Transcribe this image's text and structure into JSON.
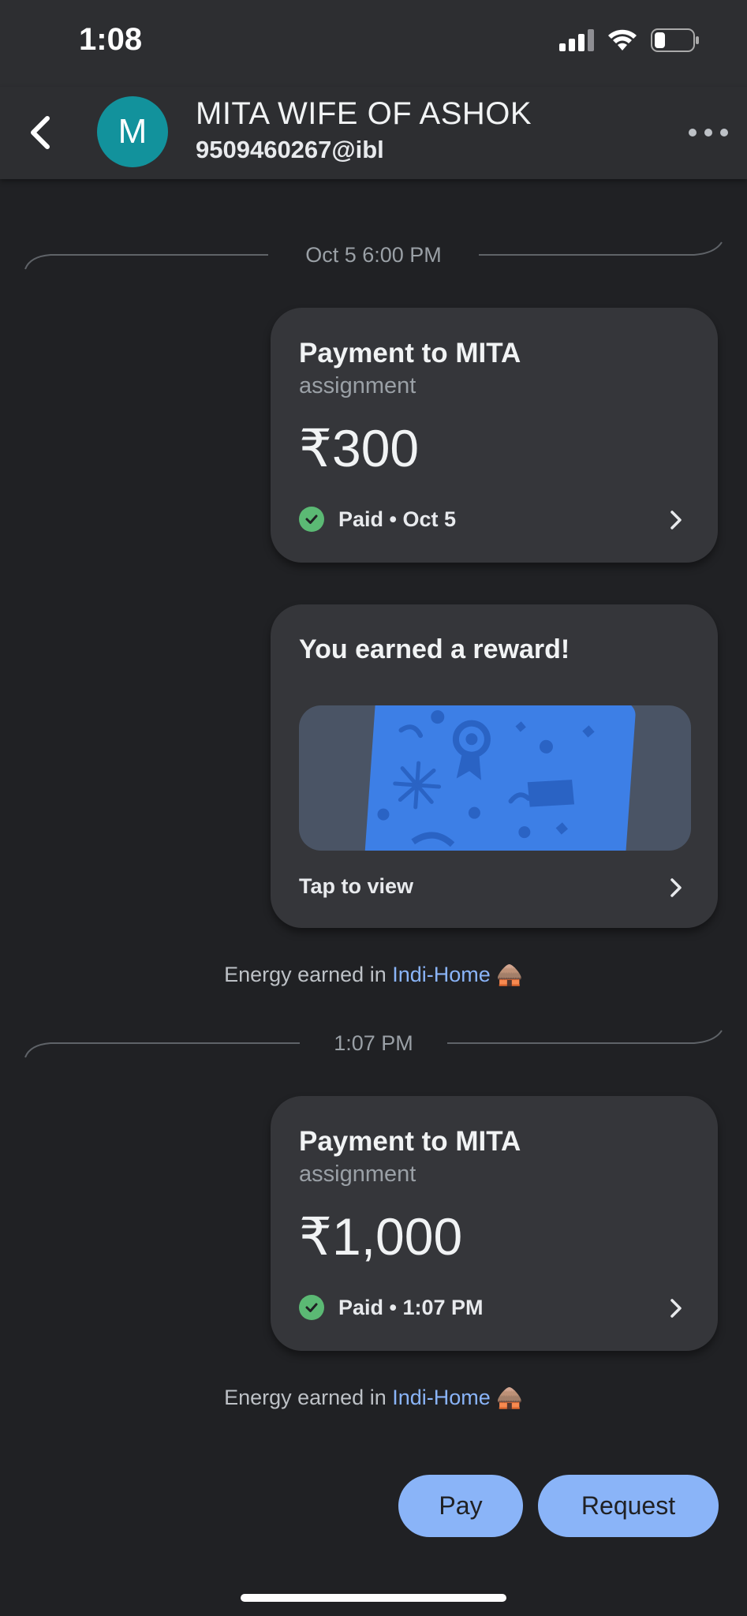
{
  "status_bar": {
    "time": "1:08"
  },
  "header": {
    "avatar_letter": "M",
    "contact_name": "MITA WIFE OF ASHOK",
    "upi_id": "9509460267@ibl"
  },
  "dividers": [
    {
      "label": "Oct 5 6:00 PM"
    },
    {
      "label": "1:07 PM"
    }
  ],
  "payments": [
    {
      "title": "Payment to MITA",
      "note": "assignment",
      "amount": "₹300",
      "status": "Paid • Oct 5"
    },
    {
      "title": "Payment to MITA",
      "note": "assignment",
      "amount": "₹1,000",
      "status": "Paid • 1:07 PM"
    }
  ],
  "reward": {
    "title": "You earned a reward!",
    "action": "Tap to view"
  },
  "energy": {
    "prefix": "Energy earned in ",
    "link": "Indi-Home",
    "emoji": "🛖"
  },
  "actions": {
    "pay": "Pay",
    "request": "Request"
  },
  "colors": {
    "accent": "#8ab4f8",
    "avatar": "#12929c",
    "success": "#5bb974",
    "reward_card": "#3d7fe6"
  }
}
